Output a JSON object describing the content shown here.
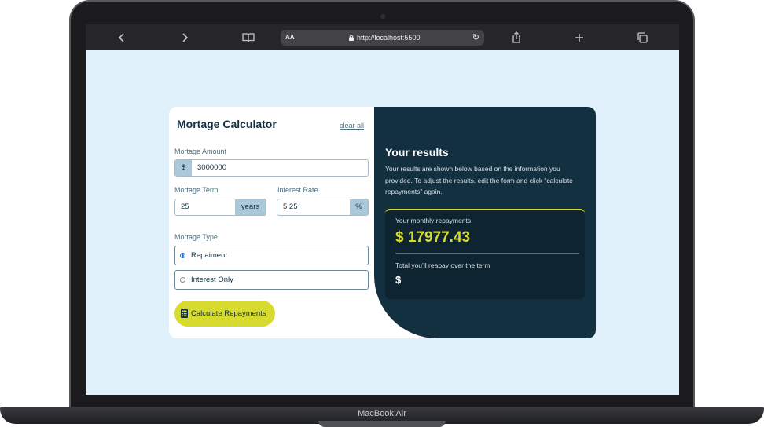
{
  "device": {
    "brand_label": "MacBook Air"
  },
  "browser": {
    "text_size_label": "AA",
    "url": "http://localhost:5500",
    "icons": [
      "back-icon",
      "forward-icon",
      "bookmarks-icon",
      "lock-icon",
      "reload-icon",
      "share-icon",
      "new-tab-icon",
      "tabs-icon"
    ]
  },
  "calculator": {
    "title": "Mortage Calculator",
    "clear_label": "clear all",
    "amount": {
      "label": "Mortage Amount",
      "prefix": "$",
      "value": "3000000"
    },
    "term": {
      "label": "Mortage Term",
      "value": "25",
      "suffix": "years"
    },
    "rate": {
      "label": "Interest Rate",
      "value": "5.25",
      "suffix": "%"
    },
    "type": {
      "label": "Mortage Type",
      "options": [
        {
          "label": "Repaiment",
          "selected": true
        },
        {
          "label": "Interest Only",
          "selected": false
        }
      ]
    },
    "submit_label": "Calculate Repayments"
  },
  "results": {
    "title": "Your results",
    "description": "Your results are shown below based on the information you provided. To adjust the results. edit the form and click “calculate repayments” again.",
    "monthly_label": "Your monthly repayments",
    "monthly_value": "$ 17977.43",
    "total_label": "Total you’ll reapay over the term",
    "total_value": "$"
  },
  "colors": {
    "accent": "#d8db2f",
    "dark_panel": "#133041",
    "page_bg": "#e0f1fb"
  }
}
